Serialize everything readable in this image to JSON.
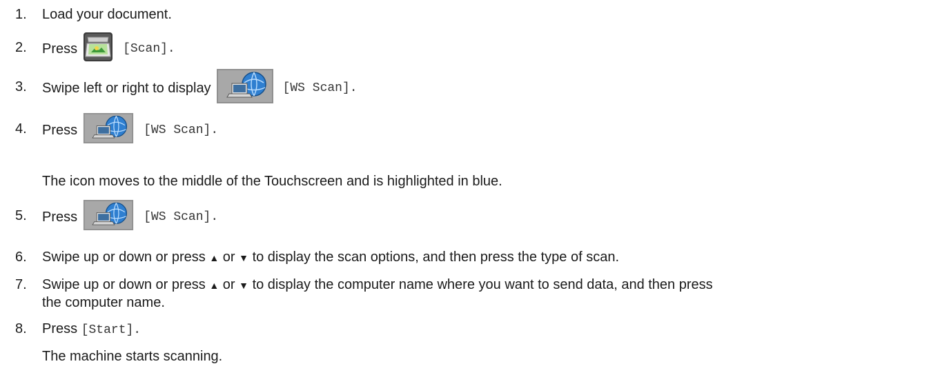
{
  "steps": [
    {
      "number": "1.",
      "text": "Load your document."
    },
    {
      "number": "2.",
      "text": "Press",
      "icon": "scan-icon",
      "label": "[Scan]."
    },
    {
      "number": "3.",
      "text": "Swipe left or right to display",
      "icon": "ws-scan-icon",
      "label": "[WS Scan]."
    },
    {
      "number": "4.",
      "text": "Press",
      "icon": "ws-scan-icon",
      "label": "[WS Scan].",
      "note": "The icon moves to the middle of the Touchscreen and is highlighted in blue."
    },
    {
      "number": "5.",
      "text": "Press",
      "icon": "ws-scan-icon",
      "label": "[WS Scan]."
    },
    {
      "number": "6.",
      "text_a": "Swipe up or down or press",
      "up": "▲",
      "or": "or",
      "down": "▼",
      "text_b": "to display the scan options, and then press the type of scan."
    },
    {
      "number": "7.",
      "text_a": "Swipe up or down or press",
      "up": "▲",
      "or": "or",
      "down": "▼",
      "text_b": "to display the computer name where you want to send data, and then press",
      "text_c": "the computer name."
    },
    {
      "number": "8.",
      "text": "Press",
      "label": "[Start].",
      "note": "The machine starts scanning."
    }
  ]
}
